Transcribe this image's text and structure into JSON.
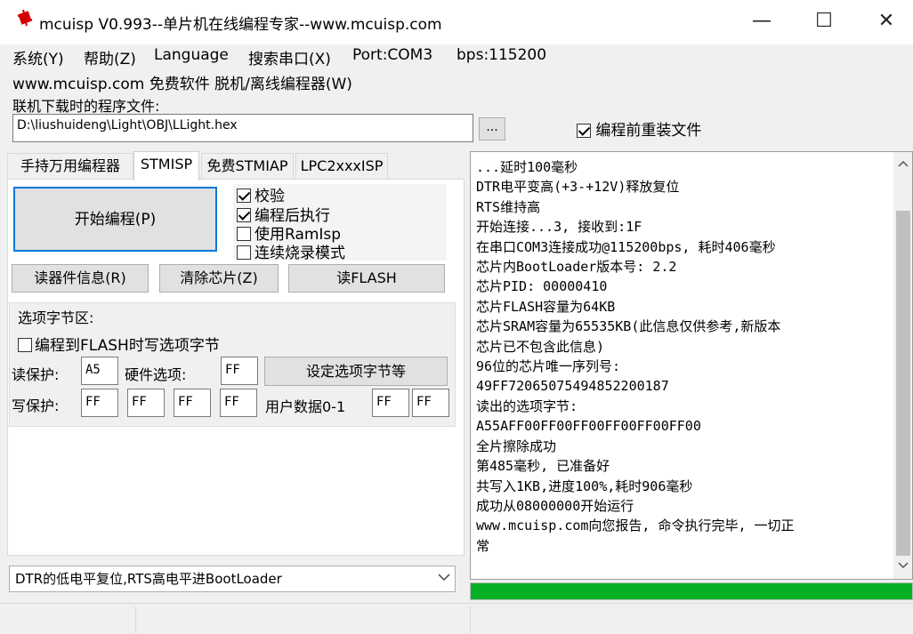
{
  "window": {
    "title": "mcuisp V0.993--单片机在线编程专家--www.mcuisp.com",
    "minimize": "—",
    "maximize": "☐",
    "close": "✕"
  },
  "menu": {
    "items": [
      "系统(Y)",
      "帮助(Z)",
      "Language",
      "搜索串口(X)",
      "Port:COM3",
      "bps:115200"
    ],
    "row2": "www.mcuisp.com 免费软件 脱机/离线编程器(W)"
  },
  "file": {
    "caption": "联机下载时的程序文件:",
    "path": "D:\\liushuideng\\Light\\OBJ\\LLight.hex",
    "browse": "...",
    "reload_label": "编程前重装文件",
    "reload_checked": true
  },
  "tabs": [
    "手持万用编程器",
    "STMISP",
    "免费STMIAP",
    "LPC2xxxISP"
  ],
  "active_tab": 1,
  "panel": {
    "start_button": "开始编程(P)",
    "options": [
      {
        "label": "校验",
        "checked": true
      },
      {
        "label": "编程后执行",
        "checked": true
      },
      {
        "label": "使用RamIsp",
        "checked": false
      },
      {
        "label": "连续烧录模式",
        "checked": false
      }
    ],
    "read_info_button": "读器件信息(R)",
    "clear_chip_button": "清除芯片(Z)",
    "read_flash_button": "读FLASH",
    "group_title": "选项字节区:",
    "write_option_label": "编程到FLASH时写选项字节",
    "write_option_checked": false,
    "read_protect_label": "读保护:",
    "read_protect_value": "A5",
    "hw_option_label": "硬件选项:",
    "hw_option_value": "FF",
    "set_option_button": "设定选项字节等",
    "write_protect_label": "写保护:",
    "write_protect_values": [
      "FF",
      "FF",
      "FF",
      "FF"
    ],
    "user_data_label": "用户数据0-1",
    "user_data_values": [
      "FF",
      "FF"
    ],
    "reset_mode": "DTR的低电平复位,RTS高电平进BootLoader"
  },
  "log": {
    "lines": [
      "...延时100毫秒",
      "DTR电平变高(+3-+12V)释放复位",
      "RTS维持高",
      "开始连接...3, 接收到:1F",
      "在串口COM3连接成功@115200bps, 耗时406毫秒",
      "芯片内BootLoader版本号: 2.2",
      "芯片PID: 00000410",
      "芯片FLASH容量为64KB",
      "芯片SRAM容量为65535KB(此信息仅供参考,新版本",
      "芯片已不包含此信息)",
      "96位的芯片唯一序列号:",
      "49FF72065075494852200187",
      "读出的选项字节:",
      "A55AFF00FF00FF00FF00FF00FF00",
      "全片擦除成功",
      "第485毫秒, 已准备好",
      "共写入1KB,进度100%,耗时906毫秒",
      "成功从08000000开始运行",
      "www.mcuisp.com向您报告, 命令执行完毕, 一切正",
      "常"
    ],
    "scroll_up": "▲",
    "scroll_down": "▼"
  },
  "progress": {
    "fraction": 1.0,
    "color": "#06b025"
  },
  "icons": {
    "app": "red-chip-icon",
    "dropdown": "chevron-down-icon"
  }
}
